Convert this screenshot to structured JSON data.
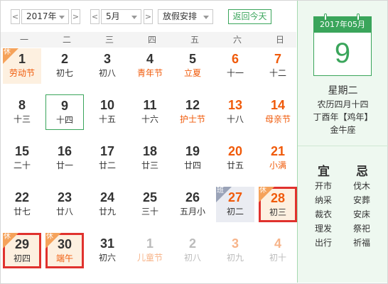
{
  "toolbar": {
    "prev_year": "<",
    "year": "2017年",
    "next_year": ">",
    "prev_month": "<",
    "month": "5月",
    "next_month": ">",
    "holiday_select": "放假安排",
    "today_button": "返回今天"
  },
  "weekdays": [
    "一",
    "二",
    "三",
    "四",
    "五",
    "六",
    "日"
  ],
  "tag_labels": {
    "rest": "休",
    "work": "班"
  },
  "days": [
    {
      "num": "1",
      "lunar": "劳动节"
    },
    {
      "num": "2",
      "lunar": "初七"
    },
    {
      "num": "3",
      "lunar": "初八"
    },
    {
      "num": "4",
      "lunar": "青年节"
    },
    {
      "num": "5",
      "lunar": "立夏"
    },
    {
      "num": "6",
      "lunar": "十一"
    },
    {
      "num": "7",
      "lunar": "十二"
    },
    {
      "num": "8",
      "lunar": "十三"
    },
    {
      "num": "9",
      "lunar": "十四"
    },
    {
      "num": "10",
      "lunar": "十五"
    },
    {
      "num": "11",
      "lunar": "十六"
    },
    {
      "num": "12",
      "lunar": "护士节"
    },
    {
      "num": "13",
      "lunar": "十八"
    },
    {
      "num": "14",
      "lunar": "母亲节"
    },
    {
      "num": "15",
      "lunar": "二十"
    },
    {
      "num": "16",
      "lunar": "廿一"
    },
    {
      "num": "17",
      "lunar": "廿二"
    },
    {
      "num": "18",
      "lunar": "廿三"
    },
    {
      "num": "19",
      "lunar": "廿四"
    },
    {
      "num": "20",
      "lunar": "廿五"
    },
    {
      "num": "21",
      "lunar": "小满"
    },
    {
      "num": "22",
      "lunar": "廿七"
    },
    {
      "num": "23",
      "lunar": "廿八"
    },
    {
      "num": "24",
      "lunar": "廿九"
    },
    {
      "num": "25",
      "lunar": "三十"
    },
    {
      "num": "26",
      "lunar": "五月小"
    },
    {
      "num": "27",
      "lunar": "初二"
    },
    {
      "num": "28",
      "lunar": "初三"
    },
    {
      "num": "29",
      "lunar": "初四"
    },
    {
      "num": "30",
      "lunar": "端午"
    },
    {
      "num": "31",
      "lunar": "初六"
    },
    {
      "num": "1",
      "lunar": "儿童节"
    },
    {
      "num": "2",
      "lunar": "初八"
    },
    {
      "num": "3",
      "lunar": "初九"
    },
    {
      "num": "4",
      "lunar": "初十"
    }
  ],
  "panel": {
    "header": "2017年05月",
    "day": "9",
    "weekday": "星期二",
    "lunar_date": "农历四月十四",
    "ganzhi": "丁酉年【鸡年】",
    "zodiac_sign": "金牛座",
    "yi_title": "宜",
    "ji_title": "忌",
    "yi_items": [
      "开市",
      "纳采",
      "裁衣",
      "理发",
      "出行"
    ],
    "ji_items": [
      "伐木",
      "安葬",
      "安床",
      "祭祀",
      "祈福"
    ]
  },
  "colors": {
    "accent_green": "#3aa55b",
    "festival_orange": "#f05a0a",
    "highlight_red": "#e0322e"
  },
  "icons": {
    "year_dropdown": "chevron-down-icon",
    "month_dropdown": "chevron-down-icon",
    "holiday_dropdown": "chevron-down-icon"
  }
}
